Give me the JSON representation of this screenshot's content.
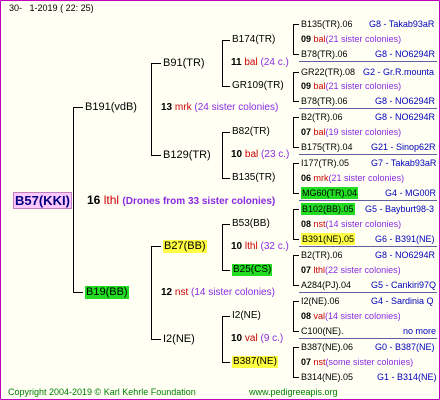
{
  "header": {
    "gen": "30-",
    "date": "1-2019",
    "time": "( 22: 25)"
  },
  "root": {
    "label": "B57(KKI)"
  },
  "root_mating": {
    "num": "16",
    "name": "lthl",
    "note": "(Drones from 33 sister colonies)"
  },
  "gen1": {
    "sire": {
      "label": "B191(vdB)"
    },
    "dam": {
      "label": "B19(BB)"
    }
  },
  "m_sire": {
    "num": "13",
    "name": "mrk",
    "note": "(24 sister colonies)"
  },
  "m_dam": {
    "num": "12",
    "name": "nst",
    "note": "(14 sister colonies)"
  },
  "gen2": {
    "b91": {
      "label": "B91(TR)"
    },
    "b129": {
      "label": "B129(TR)"
    },
    "b27": {
      "label": "B27(BB)"
    },
    "i2": {
      "label": "I2(NE)"
    }
  },
  "m_b91": {
    "num": "11",
    "name": "bal",
    "note": "(24 c.)"
  },
  "m_b129": {
    "num": "10",
    "name": "bal",
    "note": "(23 c.)"
  },
  "m_b27": {
    "num": "10",
    "name": "lthl",
    "note": "(32 c.)"
  },
  "m_i2": {
    "num": "10",
    "name": "val",
    "note": "(9 c.)"
  },
  "gen3": {
    "b174": {
      "label": "B174(TR)"
    },
    "gr109": {
      "label": "GR109(TR)"
    },
    "b82": {
      "label": "B82(TR)"
    },
    "b135": {
      "label": "B135(TR)"
    },
    "b53": {
      "label": "B53(BB)"
    },
    "b25": {
      "label": "B25(CS)"
    },
    "i2b": {
      "label": "I2(NE)"
    },
    "b387": {
      "label": "B387(NE)"
    }
  },
  "right": {
    "r1": {
      "a": "B135(TR).06",
      "b": "G8 - Takab93aR"
    },
    "r2": {
      "num": "09",
      "name": "bal",
      "note": "(21 sister colonies)"
    },
    "r3": {
      "a": "B78(TR).06",
      "b": "G8 - NO6294R"
    },
    "r4": {
      "a": "GR22(TR).08",
      "b": "G2 - Gr.R.mounta"
    },
    "r5": {
      "num": "09",
      "name": "bal",
      "note": "(21 sister colonies)"
    },
    "r6": {
      "a": "B78(TR).06",
      "b": "G8 - NO6294R"
    },
    "r7": {
      "a": "B2(TR).06",
      "b": "G8 - NO6294R"
    },
    "r8": {
      "num": "07",
      "name": "bal",
      "note": "(19 sister colonies)"
    },
    "r9": {
      "a": "B175(TR).04",
      "b": "G21 - Sinop62R"
    },
    "r10": {
      "a": "I177(TR).05",
      "b": "G7 - Takab93aR"
    },
    "r11": {
      "num": "06",
      "name": "mrk",
      "note": "(21 sister colonies)"
    },
    "r12": {
      "a": "MG60(TR).04",
      "b": "G4 - MG00R"
    },
    "r13": {
      "a": "B102(BB).05",
      "b": "G5 - Bayburt98-3"
    },
    "r14": {
      "num": "08",
      "name": "nst",
      "note": "(14 sister colonies)"
    },
    "r15": {
      "a": "B391(NE).05",
      "b": "G6 - B391(NE)"
    },
    "r16": {
      "a": "B2(TR).06",
      "b": "G8 - NO6294R"
    },
    "r17": {
      "num": "07",
      "name": "lthl",
      "note": "(22 sister colonies)"
    },
    "r18": {
      "a": "A284(PJ).04",
      "b": "G5 - Cankiri97Q"
    },
    "r19": {
      "a": "I2(NE).06",
      "b": "G4 - Sardinia Q"
    },
    "r20": {
      "num": "08",
      "name": "val",
      "note": "(14 sister colonies)"
    },
    "r21": {
      "a": "C100(NE).",
      "b": "no more"
    },
    "r22": {
      "a": "B387(NE).06",
      "b": "G0 - B387(NE)"
    },
    "r23": {
      "num": "07",
      "name": "nst",
      "note": "(some sister colonies)"
    },
    "r24": {
      "a": "B314(NE).05",
      "b": "G1 - B314(NE)"
    }
  },
  "footer": {
    "copyright": "Copyright 2004-2019 © Karl Kehrle Foundation",
    "site": "www.pedigreeapis.org"
  }
}
